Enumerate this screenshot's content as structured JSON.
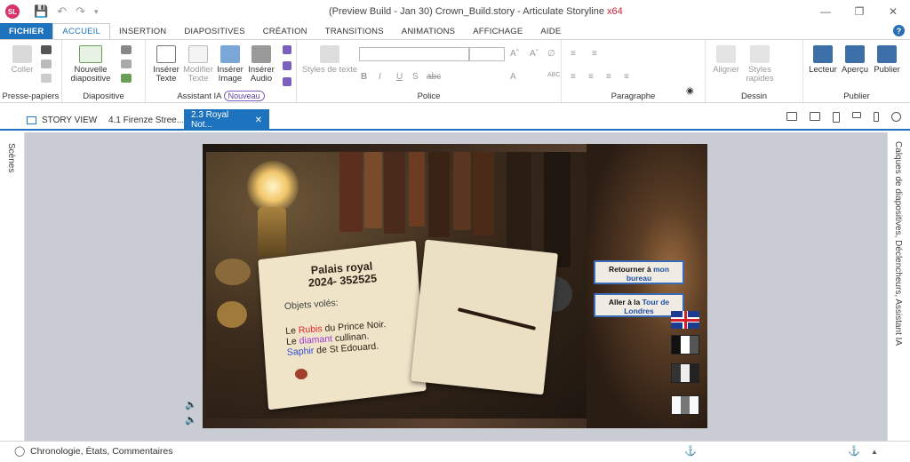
{
  "app": {
    "badge": "SL",
    "title_prefix": "(Preview Build - Jan 30) Crown_Build.story - ",
    "title_app": "Articulate Storyline",
    "title_arch": "x64"
  },
  "ribbon_tabs": [
    "FICHIER",
    "ACCUEIL",
    "INSERTION",
    "DIAPOSITIVES",
    "CRÉATION",
    "TRANSITIONS",
    "ANIMATIONS",
    "AFFICHAGE",
    "AIDE"
  ],
  "ribbon": {
    "clipboard": {
      "paste": "Coller",
      "label": "Presse-papiers"
    },
    "slide": {
      "new_line1": "Nouvelle",
      "new_line2": "diapositive",
      "label": "Diapositive"
    },
    "ai": {
      "insert_text_1": "Insérer",
      "insert_text_2": "Texte",
      "modify_text_1": "Modifier",
      "modify_text_2": "Texte",
      "insert_image_1": "Insérer",
      "insert_image_2": "Image",
      "insert_audio_1": "Insérer",
      "insert_audio_2": "Audio",
      "label": "Assistant IA",
      "badge": "Nouveau"
    },
    "font": {
      "styles": "Styles de texte",
      "label": "Police",
      "b": "B",
      "i": "I",
      "u": "U",
      "s": "S",
      "abc": "abc",
      "a": "A"
    },
    "paragraph": {
      "label": "Paragraphe"
    },
    "drawing": {
      "align": "Aligner",
      "styles_1": "Styles",
      "styles_2": "rapides",
      "label": "Dessin"
    },
    "publish": {
      "player": "Lecteur",
      "preview": "Aperçu",
      "publish": "Publier",
      "label": "Publier"
    }
  },
  "doc_tabs": {
    "story_view": "STORY VIEW",
    "tab1": "4.1 Firenze Stree...",
    "tab2": "2.3 Royal Not...",
    "close": "✕"
  },
  "panels": {
    "left": "Scènes",
    "right": "Calques de diapositives, Déclencheurs, Assistant IA"
  },
  "slide": {
    "title_line1": "Palais royal",
    "title_line2": "2024- 352525",
    "subtitle": "Objets volés:",
    "line1_pre": "Le ",
    "line1_word": "Rubis",
    "line1_post": " du Prince Noir.",
    "line2_pre": "Le ",
    "line2_word": "diamant",
    "line2_post": " cullinan.",
    "line3_word": "Saphir",
    "line3_post": " de St Edouard.",
    "btn1_pre": "Retourner à ",
    "btn1_hl1": "mon",
    "btn1_hl2": "bureau",
    "btn2_pre": "Aller à la ",
    "btn2_hl1": "Tour de",
    "btn2_hl2": "Londres"
  },
  "bottom": {
    "label": "Chronologie, États, Commentaires"
  },
  "colors": {
    "accent": "#1e73be",
    "rubis": "#e4262b",
    "diamant": "#9b3bd6",
    "saphir": "#2d4ad8"
  }
}
